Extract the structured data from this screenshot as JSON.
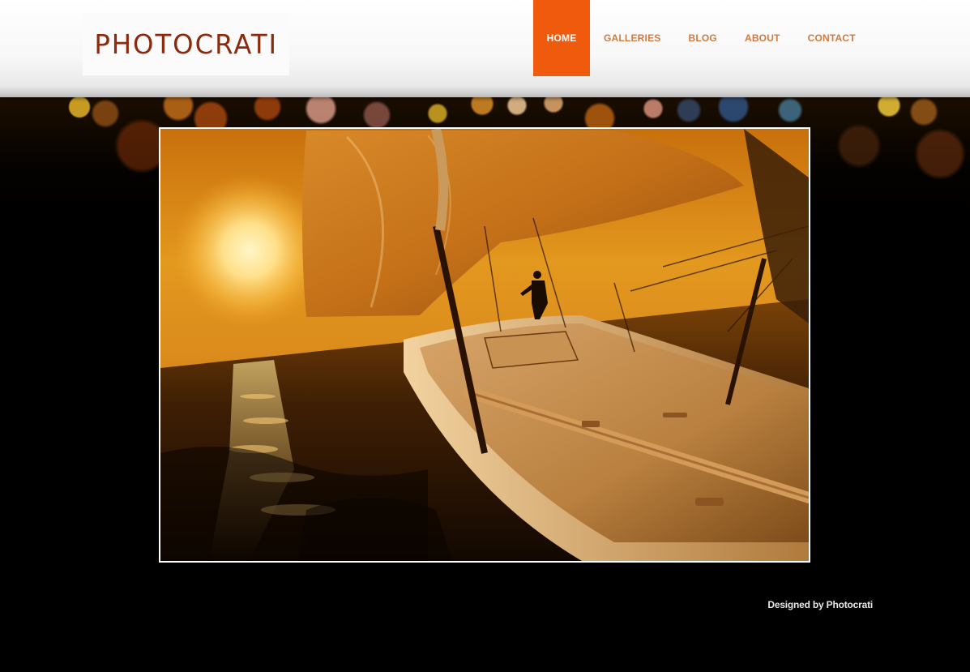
{
  "header": {
    "logo_text": "PHOTOCRATI"
  },
  "nav": {
    "items": [
      {
        "label": "HOME",
        "active": true
      },
      {
        "label": "GALLERIES",
        "active": false
      },
      {
        "label": "BLOG",
        "active": false
      },
      {
        "label": "ABOUT",
        "active": false
      },
      {
        "label": "CONTACT",
        "active": false
      }
    ]
  },
  "main": {
    "slideshow_image": "sailboat-sunset-photo"
  },
  "footer": {
    "credit": "Designed by Photocrati"
  },
  "colors": {
    "accent": "#f05a0c",
    "nav_text": "#d07a3f",
    "logo": "#8b2a0c",
    "background": "#000000"
  }
}
